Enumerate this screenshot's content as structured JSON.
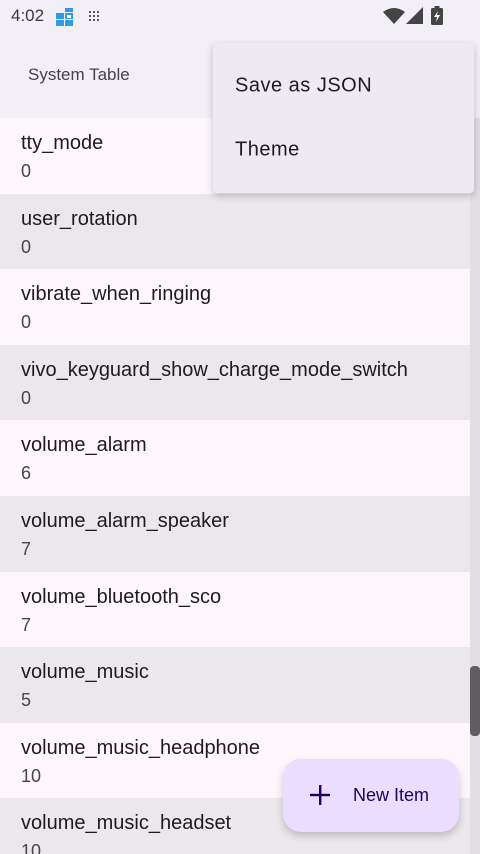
{
  "status_bar": {
    "time": "4:02",
    "icons": [
      "app-notification-icon",
      "grid-notification-icon",
      "wifi-icon",
      "signal-icon",
      "battery-icon"
    ]
  },
  "app_bar": {
    "title": "System Table"
  },
  "menu": {
    "items": [
      {
        "label": "Save as JSON"
      },
      {
        "label": "Theme"
      }
    ]
  },
  "list": {
    "items": [
      {
        "key": "tty_mode",
        "value": "0"
      },
      {
        "key": "user_rotation",
        "value": "0"
      },
      {
        "key": "vibrate_when_ringing",
        "value": "0"
      },
      {
        "key": "vivo_keyguard_show_charge_mode_switch",
        "value": "0"
      },
      {
        "key": "volume_alarm",
        "value": "6"
      },
      {
        "key": "volume_alarm_speaker",
        "value": "7"
      },
      {
        "key": "volume_bluetooth_sco",
        "value": "7"
      },
      {
        "key": "volume_music",
        "value": "5"
      },
      {
        "key": "volume_music_headphone",
        "value": "10"
      },
      {
        "key": "volume_music_headset",
        "value": "10"
      }
    ]
  },
  "fab": {
    "label": "New Item",
    "icon": "plus-icon"
  },
  "colors": {
    "background": "#f3eff6",
    "row_light": "#fdf7fc",
    "row_dark": "#ebe8ec",
    "fab_background": "#eaddff",
    "menu_background": "#efeaf1"
  }
}
